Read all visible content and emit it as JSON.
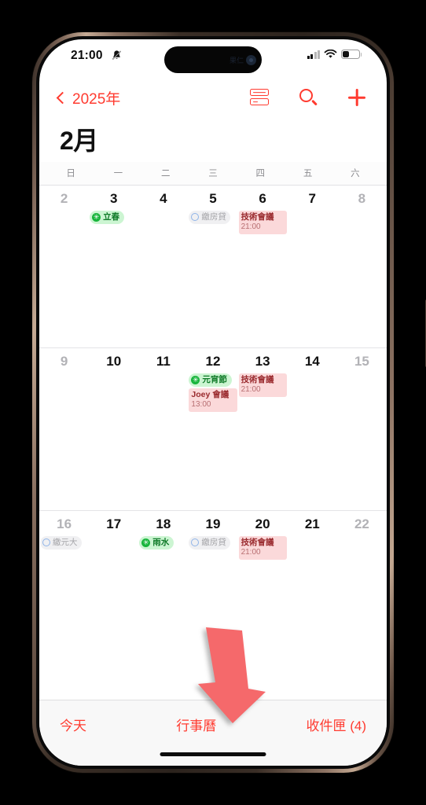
{
  "status_bar": {
    "time": "21:00",
    "silent_icon": "bell-slash-icon",
    "cellular_icon": "signal-bars-icon",
    "wifi_icon": "wifi-icon",
    "battery_icon": "battery-icon",
    "island_label": "果仁",
    "island_avatar": "contact-avatar-icon"
  },
  "nav": {
    "back_label": "2025年",
    "back_icon": "chevron-left-icon",
    "list_icon": "list-view-icon",
    "search_icon": "search-icon",
    "add_icon": "plus-icon"
  },
  "header": {
    "month_title": "2月",
    "weekdays": [
      "日",
      "一",
      "二",
      "三",
      "四",
      "五",
      "六"
    ]
  },
  "weeks": [
    {
      "days": [
        {
          "num": "2",
          "dim": true,
          "events": []
        },
        {
          "num": "3",
          "dim": false,
          "events": [
            {
              "kind": "holiday",
              "title": "立春"
            }
          ]
        },
        {
          "num": "4",
          "dim": false,
          "events": []
        },
        {
          "num": "5",
          "dim": false,
          "events": [
            {
              "kind": "reminder",
              "title": "繳房貸"
            }
          ]
        },
        {
          "num": "6",
          "dim": false,
          "events": [
            {
              "kind": "event",
              "title": "技術會議",
              "time": "21:00"
            }
          ]
        },
        {
          "num": "7",
          "dim": false,
          "events": []
        },
        {
          "num": "8",
          "dim": true,
          "events": []
        }
      ]
    },
    {
      "days": [
        {
          "num": "9",
          "dim": true,
          "events": []
        },
        {
          "num": "10",
          "dim": false,
          "events": []
        },
        {
          "num": "11",
          "dim": false,
          "events": []
        },
        {
          "num": "12",
          "dim": false,
          "events": [
            {
              "kind": "holiday",
              "title": "元宵節"
            },
            {
              "kind": "event",
              "title": "Joey 會議",
              "time": "13:00"
            }
          ]
        },
        {
          "num": "13",
          "dim": false,
          "events": [
            {
              "kind": "event",
              "title": "技術會議",
              "time": "21:00"
            }
          ]
        },
        {
          "num": "14",
          "dim": false,
          "events": []
        },
        {
          "num": "15",
          "dim": true,
          "events": []
        }
      ]
    },
    {
      "days": [
        {
          "num": "16",
          "dim": true,
          "events": [
            {
              "kind": "reminder",
              "title": "繳元大"
            }
          ]
        },
        {
          "num": "17",
          "dim": false,
          "events": []
        },
        {
          "num": "18",
          "dim": false,
          "events": [
            {
              "kind": "holiday",
              "title": "雨水"
            }
          ]
        },
        {
          "num": "19",
          "dim": false,
          "events": [
            {
              "kind": "reminder",
              "title": "繳房貸"
            }
          ]
        },
        {
          "num": "20",
          "dim": false,
          "events": [
            {
              "kind": "event",
              "title": "技術會議",
              "time": "21:00"
            }
          ]
        },
        {
          "num": "21",
          "dim": false,
          "events": []
        },
        {
          "num": "22",
          "dim": true,
          "events": []
        }
      ]
    }
  ],
  "toolbar": {
    "today_label": "今天",
    "calendars_label": "行事曆",
    "inbox_label": "收件匣 (4)"
  },
  "annotation": {
    "arrow_icon": "down-arrow-annotation",
    "arrow_color": "#f5696b"
  },
  "colors": {
    "accent": "#ff3b30",
    "holiday_bg": "#ccf5d2",
    "holiday_text": "#0f7a28",
    "event_bg": "#fbd9da",
    "event_text": "#9a2a2e",
    "reminder_bg": "#f0f0f2",
    "reminder_text": "#a4a4a8"
  }
}
